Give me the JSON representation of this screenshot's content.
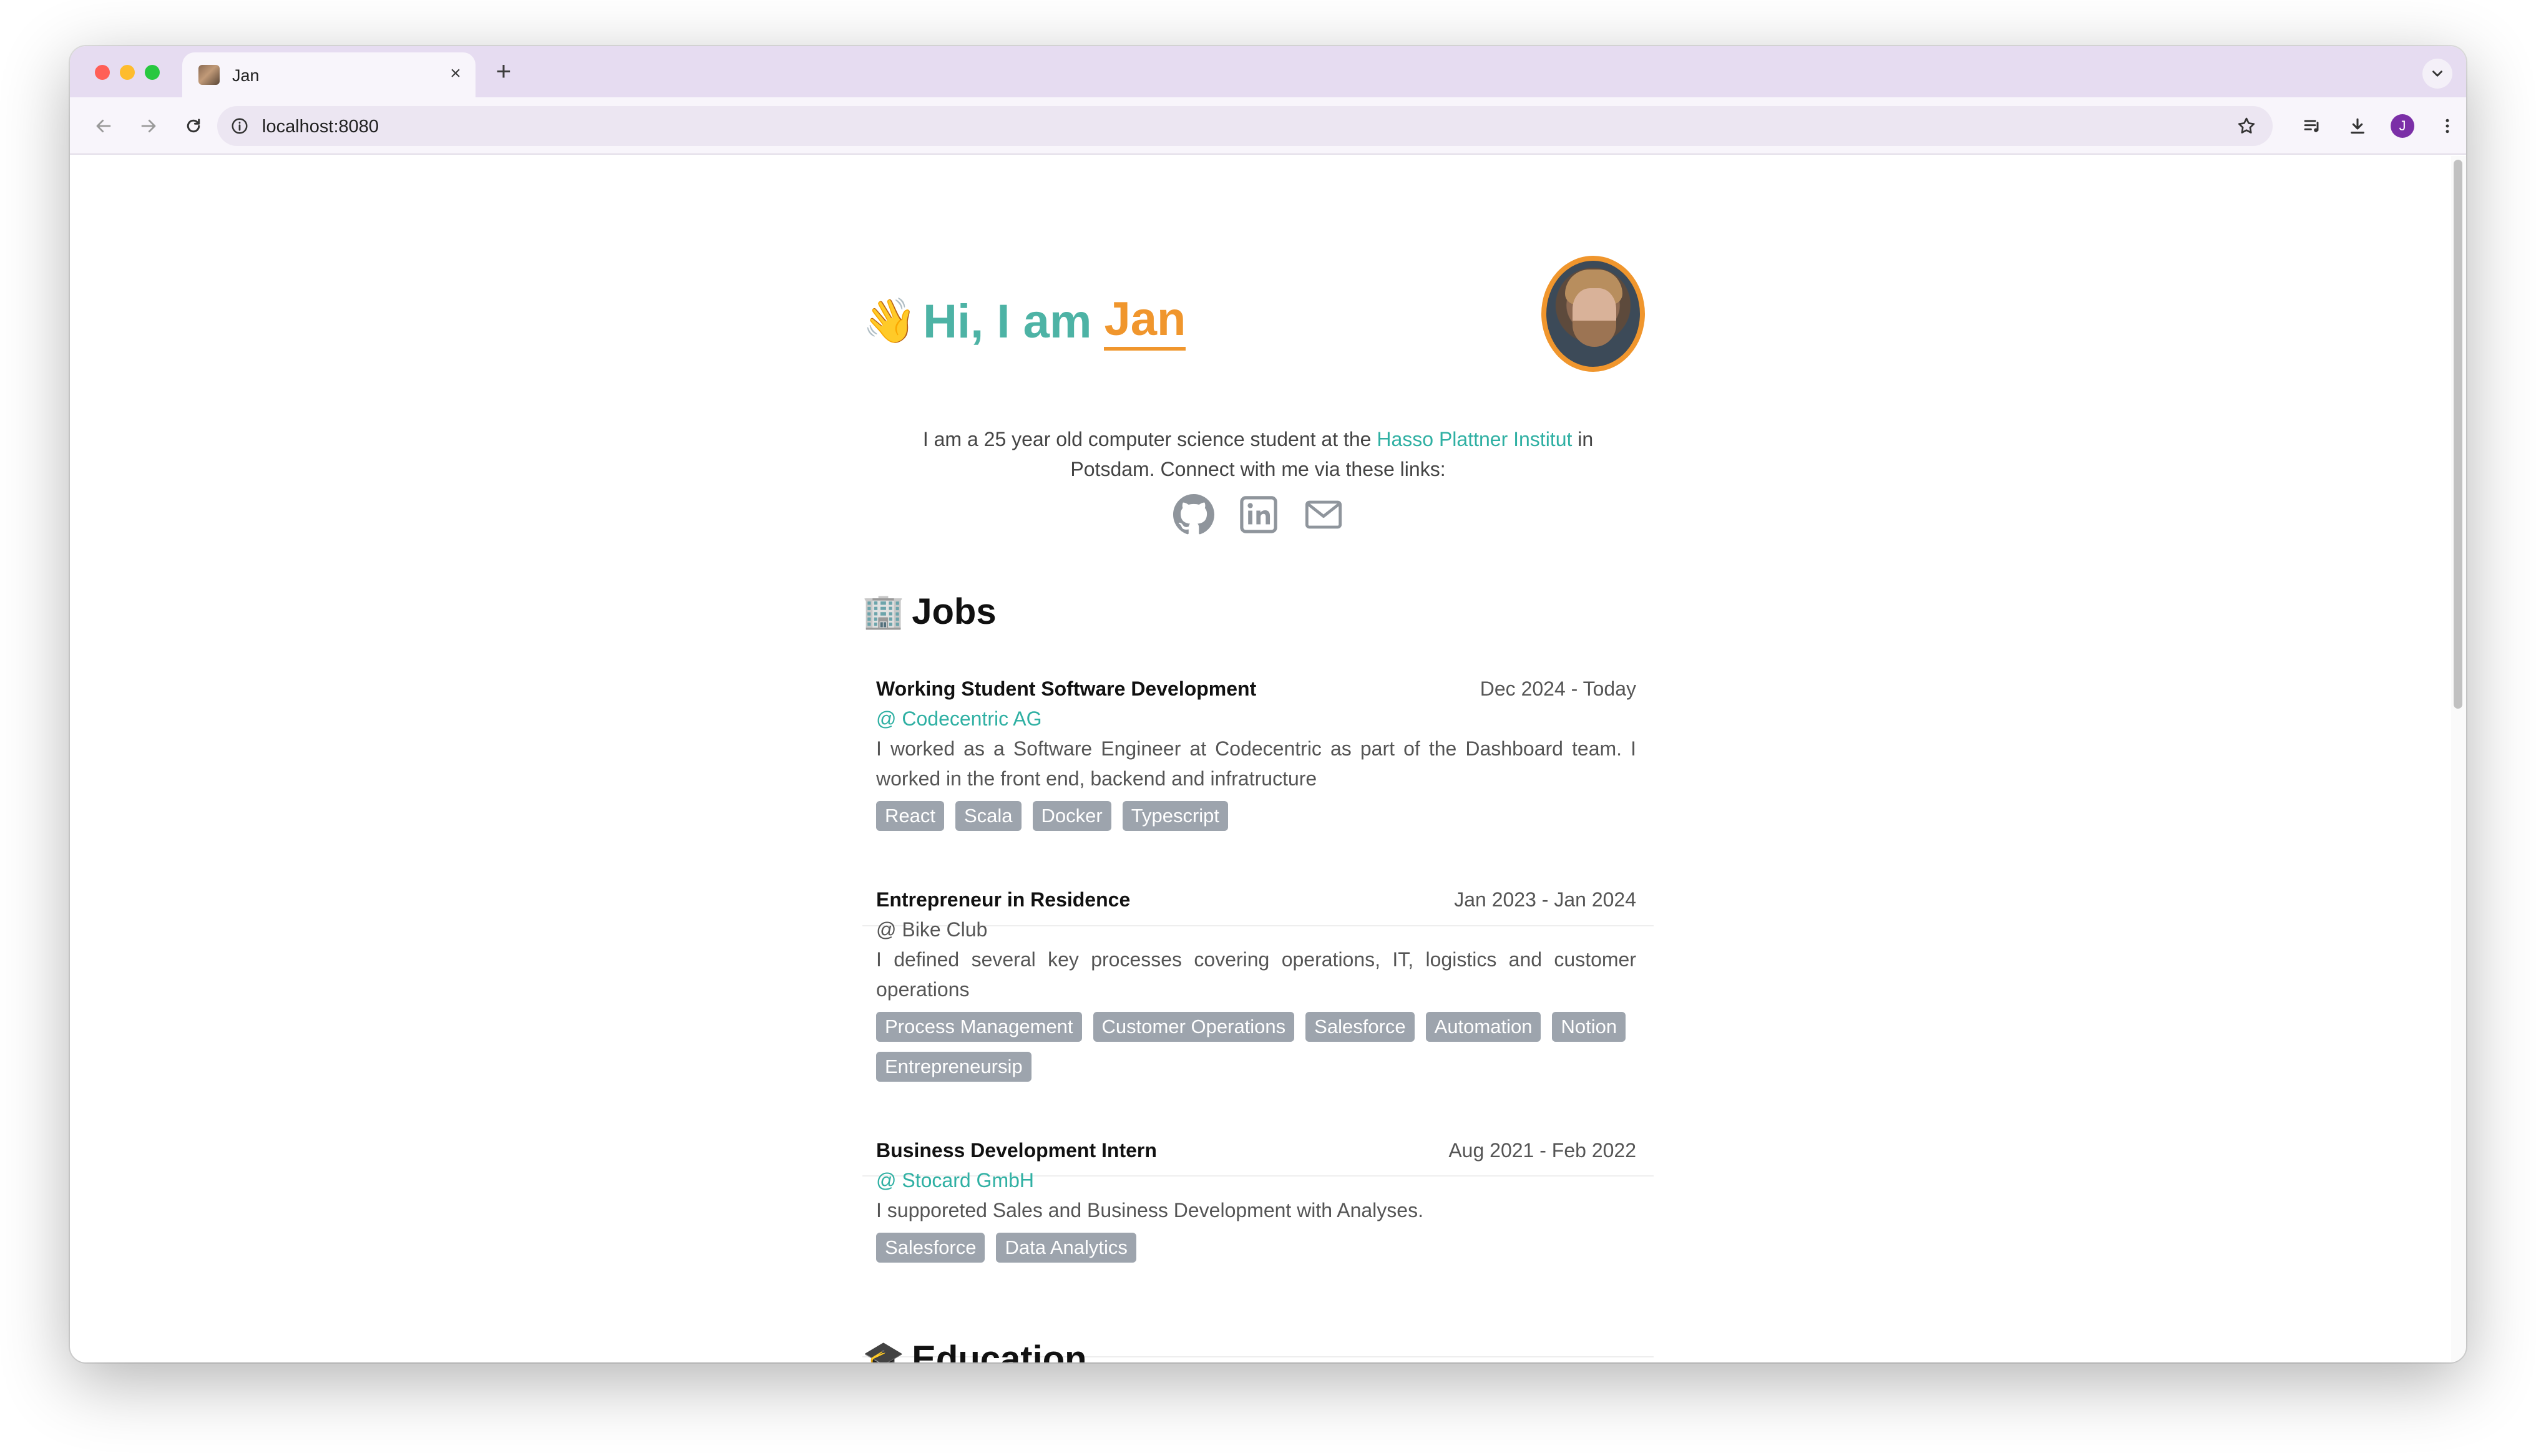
{
  "browser": {
    "tab_title": "Jan",
    "tab_close": "×",
    "new_tab": "+",
    "url": "localhost:8080",
    "profile_initial": "J"
  },
  "hero": {
    "wave_emoji": "👋",
    "greeting": "Hi, I am",
    "name": "Jan",
    "intro_before": "I am a 25 year old computer science student at the ",
    "intro_link": "Hasso Plattner Institut",
    "intro_after": " in Potsdam. Connect with me via these links:",
    "social_icons": [
      "github-icon",
      "linkedin-icon",
      "mail-icon"
    ]
  },
  "jobs": {
    "emoji": "🏢",
    "heading": "Jobs",
    "items": [
      {
        "title": "Working Student Software Development",
        "dates": "Dec 2024 - Today",
        "company": "@ Codecentric AG",
        "company_is_link": true,
        "description": "I worked as a Software Engineer at Codecentric as part of the Dashboard team. I worked in the front end, backend and infratructure",
        "tags": [
          "React",
          "Scala",
          "Docker",
          "Typescript"
        ]
      },
      {
        "title": "Entrepreneur in Residence",
        "dates": "Jan 2023 - Jan 2024",
        "company": "@ Bike Club",
        "company_is_link": false,
        "description": "I defined several key processes covering operations, IT, logistics and customer operations",
        "tags": [
          "Process Management",
          "Customer Operations",
          "Salesforce",
          "Automation",
          "Notion",
          "Entrepreneursip"
        ]
      },
      {
        "title": "Business Development Intern",
        "dates": "Aug 2021 - Feb 2022",
        "company": "@ Stocard GmbH",
        "company_is_link": true,
        "description": "I supporeted Sales and Business Development with Analyses.",
        "tags": [
          "Salesforce",
          "Data Analytics"
        ]
      }
    ]
  },
  "next_section": {
    "emoji": "🎓",
    "heading": "Education"
  },
  "colors": {
    "accent_teal": "#4db3a5",
    "accent_orange": "#f0962d",
    "link": "#2fb0a3",
    "tag_bg": "#9da4ad"
  }
}
